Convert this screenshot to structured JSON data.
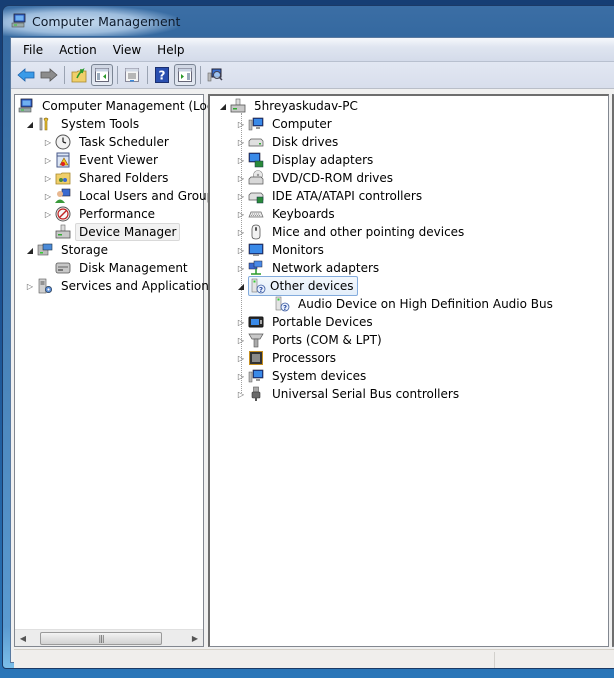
{
  "window": {
    "title": "Computer Management",
    "app_icon": "computer-management-icon"
  },
  "menu": {
    "items": [
      "File",
      "Action",
      "View",
      "Help"
    ]
  },
  "toolbar": {
    "buttons": [
      {
        "name": "back",
        "icon": "back-arrow-icon",
        "tooltip": "Back"
      },
      {
        "name": "forward",
        "icon": "forward-arrow-icon",
        "tooltip": "Forward"
      },
      {
        "name": "up-one-level",
        "icon": "folder-up-icon",
        "tooltip": "Up one level"
      },
      {
        "name": "show-hide-console-tree",
        "icon": "console-tree-icon",
        "tooltip": "Show/Hide Console Tree",
        "pressed": true
      },
      {
        "name": "properties",
        "icon": "properties-icon",
        "tooltip": "Properties"
      },
      {
        "name": "help",
        "icon": "help-icon",
        "tooltip": "Help"
      },
      {
        "name": "show-hide-action-pane",
        "icon": "action-pane-icon",
        "tooltip": "Show/Hide Action Pane",
        "pressed": true
      },
      {
        "name": "scan-hardware",
        "icon": "scan-hardware-icon",
        "tooltip": "Scan for hardware changes"
      }
    ]
  },
  "left_tree": {
    "nodes": [
      {
        "label": "Computer Management (Local",
        "icon": "computer-management-icon",
        "level": 0,
        "expander": "none"
      },
      {
        "label": "System Tools",
        "icon": "tools-icon",
        "level": 1,
        "expander": "open"
      },
      {
        "label": "Task Scheduler",
        "icon": "clock-icon",
        "level": 2,
        "expander": "closed"
      },
      {
        "label": "Event Viewer",
        "icon": "event-viewer-icon",
        "level": 2,
        "expander": "closed"
      },
      {
        "label": "Shared Folders",
        "icon": "shared-folder-icon",
        "level": 2,
        "expander": "closed"
      },
      {
        "label": "Local Users and Groups",
        "icon": "users-icon",
        "level": 2,
        "expander": "closed"
      },
      {
        "label": "Performance",
        "icon": "performance-icon",
        "level": 2,
        "expander": "closed"
      },
      {
        "label": "Device Manager",
        "icon": "device-manager-icon",
        "level": 2,
        "expander": "none",
        "selected": true
      },
      {
        "label": "Storage",
        "icon": "storage-icon",
        "level": 1,
        "expander": "open"
      },
      {
        "label": "Disk Management",
        "icon": "disk-management-icon",
        "level": 2,
        "expander": "none"
      },
      {
        "label": "Services and Applications",
        "icon": "services-icon",
        "level": 1,
        "expander": "closed"
      }
    ]
  },
  "device_tree": {
    "root": {
      "label": "5hreyaskudav-PC",
      "icon": "computer-pc-icon",
      "expander": "open"
    },
    "categories": [
      {
        "label": "Computer",
        "icon": "computer-icon",
        "expander": "closed"
      },
      {
        "label": "Disk drives",
        "icon": "disk-drive-icon",
        "expander": "closed"
      },
      {
        "label": "Display adapters",
        "icon": "display-adapter-icon",
        "expander": "closed"
      },
      {
        "label": "DVD/CD-ROM drives",
        "icon": "dvd-drive-icon",
        "expander": "closed"
      },
      {
        "label": "IDE ATA/ATAPI controllers",
        "icon": "ide-controller-icon",
        "expander": "closed"
      },
      {
        "label": "Keyboards",
        "icon": "keyboard-icon",
        "expander": "closed"
      },
      {
        "label": "Mice and other pointing devices",
        "icon": "mouse-icon",
        "expander": "closed"
      },
      {
        "label": "Monitors",
        "icon": "monitor-icon",
        "expander": "closed"
      },
      {
        "label": "Network adapters",
        "icon": "network-adapter-icon",
        "expander": "closed"
      },
      {
        "label": "Other devices",
        "icon": "unknown-device-icon",
        "expander": "open",
        "selected": true,
        "children": [
          {
            "label": "Audio Device on High Definition Audio Bus",
            "icon": "unknown-device-icon"
          }
        ]
      },
      {
        "label": "Portable Devices",
        "icon": "portable-device-icon",
        "expander": "closed"
      },
      {
        "label": "Ports (COM & LPT)",
        "icon": "port-icon",
        "expander": "closed"
      },
      {
        "label": "Processors",
        "icon": "processor-icon",
        "expander": "closed"
      },
      {
        "label": "System devices",
        "icon": "system-devices-icon",
        "expander": "closed"
      },
      {
        "label": "Universal Serial Bus controllers",
        "icon": "usb-icon",
        "expander": "closed"
      }
    ]
  },
  "left_scrollbar": {
    "position_fraction": 0.05,
    "visible_fraction": 0.8
  },
  "status_bar": {
    "text": ""
  }
}
